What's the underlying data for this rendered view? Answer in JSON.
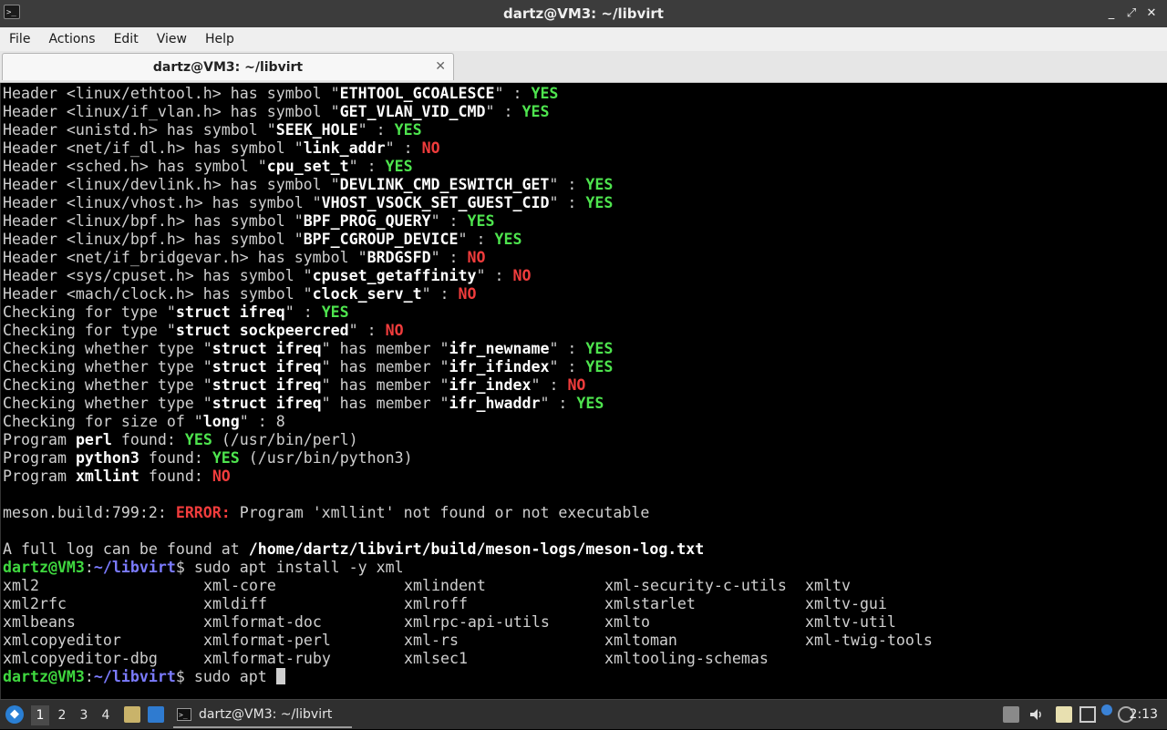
{
  "window": {
    "title": "dartz@VM3: ~/libvirt",
    "app_icon": ">_",
    "controls": [
      "_",
      "⤢",
      "✕"
    ]
  },
  "menubar": {
    "items": [
      "File",
      "Actions",
      "Edit",
      "View",
      "Help"
    ]
  },
  "tab": {
    "label": "dartz@VM3: ~/libvirt",
    "close": "✕"
  },
  "terminal": {
    "lines": [
      [
        [
          "Header <linux/ethtool.h> has symbol \"",
          ""
        ],
        [
          "ETHTOOL_GCOALESCE",
          "b"
        ],
        [
          "\" : ",
          ""
        ],
        [
          "YES",
          "yes"
        ]
      ],
      [
        [
          "Header <linux/if_vlan.h> has symbol \"",
          ""
        ],
        [
          "GET_VLAN_VID_CMD",
          "b"
        ],
        [
          "\" : ",
          ""
        ],
        [
          "YES",
          "yes"
        ]
      ],
      [
        [
          "Header <unistd.h> has symbol \"",
          ""
        ],
        [
          "SEEK_HOLE",
          "b"
        ],
        [
          "\" : ",
          ""
        ],
        [
          "YES",
          "yes"
        ]
      ],
      [
        [
          "Header <net/if_dl.h> has symbol \"",
          ""
        ],
        [
          "link_addr",
          "b"
        ],
        [
          "\" : ",
          ""
        ],
        [
          "NO",
          "no"
        ]
      ],
      [
        [
          "Header <sched.h> has symbol \"",
          ""
        ],
        [
          "cpu_set_t",
          "b"
        ],
        [
          "\" : ",
          ""
        ],
        [
          "YES",
          "yes"
        ]
      ],
      [
        [
          "Header <linux/devlink.h> has symbol \"",
          ""
        ],
        [
          "DEVLINK_CMD_ESWITCH_GET",
          "b"
        ],
        [
          "\" : ",
          ""
        ],
        [
          "YES",
          "yes"
        ]
      ],
      [
        [
          "Header <linux/vhost.h> has symbol \"",
          ""
        ],
        [
          "VHOST_VSOCK_SET_GUEST_CID",
          "b"
        ],
        [
          "\" : ",
          ""
        ],
        [
          "YES",
          "yes"
        ]
      ],
      [
        [
          "Header <linux/bpf.h> has symbol \"",
          ""
        ],
        [
          "BPF_PROG_QUERY",
          "b"
        ],
        [
          "\" : ",
          ""
        ],
        [
          "YES",
          "yes"
        ]
      ],
      [
        [
          "Header <linux/bpf.h> has symbol \"",
          ""
        ],
        [
          "BPF_CGROUP_DEVICE",
          "b"
        ],
        [
          "\" : ",
          ""
        ],
        [
          "YES",
          "yes"
        ]
      ],
      [
        [
          "Header <net/if_bridgevar.h> has symbol \"",
          ""
        ],
        [
          "BRDGSFD",
          "b"
        ],
        [
          "\" : ",
          ""
        ],
        [
          "NO",
          "no"
        ]
      ],
      [
        [
          "Header <sys/cpuset.h> has symbol \"",
          ""
        ],
        [
          "cpuset_getaffinity",
          "b"
        ],
        [
          "\" : ",
          ""
        ],
        [
          "NO",
          "no"
        ]
      ],
      [
        [
          "Header <mach/clock.h> has symbol \"",
          ""
        ],
        [
          "clock_serv_t",
          "b"
        ],
        [
          "\" : ",
          ""
        ],
        [
          "NO",
          "no"
        ]
      ],
      [
        [
          "Checking for type \"",
          ""
        ],
        [
          "struct ifreq",
          "b"
        ],
        [
          "\" : ",
          ""
        ],
        [
          "YES",
          "yes"
        ]
      ],
      [
        [
          "Checking for type \"",
          ""
        ],
        [
          "struct sockpeercred",
          "b"
        ],
        [
          "\" : ",
          ""
        ],
        [
          "NO",
          "no"
        ]
      ],
      [
        [
          "Checking whether type \"",
          ""
        ],
        [
          "struct ifreq",
          "b"
        ],
        [
          "\" has member \"",
          ""
        ],
        [
          "ifr_newname",
          "b"
        ],
        [
          "\" : ",
          ""
        ],
        [
          "YES",
          "yes"
        ]
      ],
      [
        [
          "Checking whether type \"",
          ""
        ],
        [
          "struct ifreq",
          "b"
        ],
        [
          "\" has member \"",
          ""
        ],
        [
          "ifr_ifindex",
          "b"
        ],
        [
          "\" : ",
          ""
        ],
        [
          "YES",
          "yes"
        ]
      ],
      [
        [
          "Checking whether type \"",
          ""
        ],
        [
          "struct ifreq",
          "b"
        ],
        [
          "\" has member \"",
          ""
        ],
        [
          "ifr_index",
          "b"
        ],
        [
          "\" : ",
          ""
        ],
        [
          "NO",
          "no"
        ]
      ],
      [
        [
          "Checking whether type \"",
          ""
        ],
        [
          "struct ifreq",
          "b"
        ],
        [
          "\" has member \"",
          ""
        ],
        [
          "ifr_hwaddr",
          "b"
        ],
        [
          "\" : ",
          ""
        ],
        [
          "YES",
          "yes"
        ]
      ],
      [
        [
          "Checking for size of \"",
          ""
        ],
        [
          "long",
          "b"
        ],
        [
          "\" : 8",
          ""
        ]
      ],
      [
        [
          "Program ",
          ""
        ],
        [
          "perl",
          "b"
        ],
        [
          " found: ",
          ""
        ],
        [
          "YES",
          "yes"
        ],
        [
          " (/usr/bin/perl)",
          ""
        ]
      ],
      [
        [
          "Program ",
          ""
        ],
        [
          "python3",
          "b"
        ],
        [
          " found: ",
          ""
        ],
        [
          "YES",
          "yes"
        ],
        [
          " (/usr/bin/python3)",
          ""
        ]
      ],
      [
        [
          "Program ",
          ""
        ],
        [
          "xmllint",
          "b"
        ],
        [
          " found: ",
          ""
        ],
        [
          "NO",
          "no"
        ]
      ],
      [
        [
          "",
          ""
        ]
      ],
      [
        [
          "meson.build:799:2: ",
          ""
        ],
        [
          "ERROR:",
          "err"
        ],
        [
          " Program 'xmllint' not found or not executable",
          ""
        ]
      ],
      [
        [
          "",
          ""
        ]
      ],
      [
        [
          "A full log can be found at ",
          ""
        ],
        [
          "/home/dartz/libvirt/build/meson-logs/meson-log.txt",
          "b"
        ]
      ]
    ],
    "prompt_user": "dartz@VM3",
    "prompt_sep": ":",
    "prompt_path": "~/libvirt",
    "prompt_dollar": "$ ",
    "command1": "sudo apt install -y xml",
    "completions": [
      [
        "xml2",
        "xml-core",
        "xmlindent",
        "xml-security-c-utils",
        "xmltv"
      ],
      [
        "xml2rfc",
        "xmldiff",
        "xmlroff",
        "xmlstarlet",
        "xmltv-gui"
      ],
      [
        "xmlbeans",
        "xmlformat-doc",
        "xmlrpc-api-utils",
        "xmlto",
        "xmltv-util"
      ],
      [
        "xmlcopyeditor",
        "xmlformat-perl",
        "xml-rs",
        "xmltoman",
        "xml-twig-tools"
      ],
      [
        "xmlcopyeditor-dbg",
        "xmlformat-ruby",
        "xmlsec1",
        "xmltooling-schemas",
        ""
      ]
    ],
    "command2": "sudo apt "
  },
  "taskbar": {
    "workspaces": [
      "1",
      "2",
      "3",
      "4"
    ],
    "active_workspace": "1",
    "task_label": "dartz@VM3: ~/libvirt",
    "clock": "2:13"
  }
}
